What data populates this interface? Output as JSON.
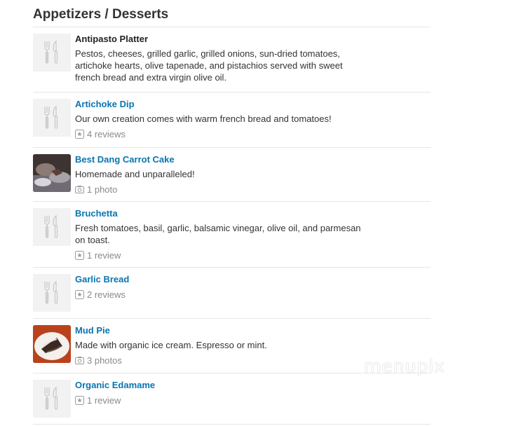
{
  "section": {
    "title": "Appetizers / Desserts"
  },
  "items": [
    {
      "name": "Antipasto Platter",
      "linked": false,
      "thumb": "fork-knife-icon",
      "description": "Pestos, cheeses, grilled garlic, grilled onions, sun-dried tomatoes, artichoke hearts, olive tapenade, and pistachios served with sweet french bread and extra virgin olive oil.",
      "meta": ""
    },
    {
      "name": "Artichoke Dip",
      "linked": true,
      "thumb": "fork-knife-icon",
      "description": "Our own creation comes with warm french bread and tomatoes!",
      "meta": "4 reviews",
      "meta_icon": "review-star-icon"
    },
    {
      "name": "Best Dang Carrot Cake",
      "linked": true,
      "thumb": "photo",
      "description": "Homemade and unparalleled!",
      "meta": "1 photo",
      "meta_icon": "camera-icon"
    },
    {
      "name": "Bruchetta",
      "linked": true,
      "thumb": "fork-knife-icon",
      "description": "Fresh tomatoes, basil, garlic, balsamic vinegar, olive oil, and parmesan on toast.",
      "meta": "1 review",
      "meta_icon": "review-star-icon"
    },
    {
      "name": "Garlic Bread",
      "linked": true,
      "thumb": "fork-knife-icon",
      "description": "",
      "meta": "2 reviews",
      "meta_icon": "review-star-icon"
    },
    {
      "name": "Mud Pie",
      "linked": true,
      "thumb": "photo",
      "description": "Made with organic ice cream. Espresso or mint.",
      "meta": "3 photos",
      "meta_icon": "camera-icon"
    },
    {
      "name": "Organic Edamame",
      "linked": true,
      "thumb": "fork-knife-icon",
      "description": "",
      "meta": "1 review",
      "meta_icon": "review-star-icon"
    }
  ],
  "watermark": "menupix",
  "colors": {
    "link": "#0a74b0",
    "text": "#333333",
    "muted": "#8a8a8a",
    "divider": "#e6e6e6",
    "thumb_bg": "#f2f2f2"
  }
}
